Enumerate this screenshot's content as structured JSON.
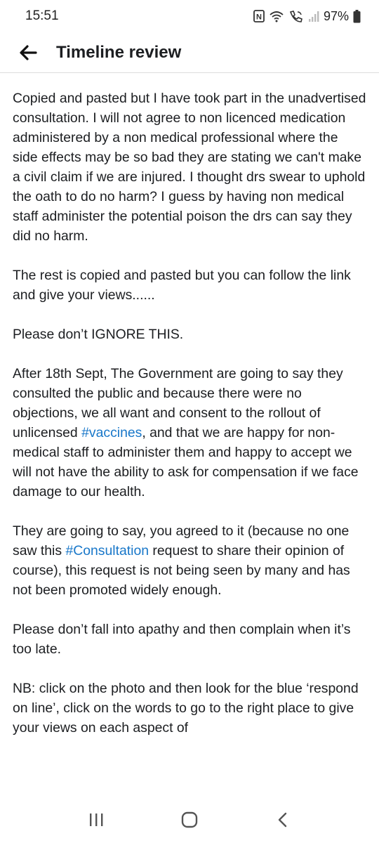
{
  "status_bar": {
    "time": "15:51",
    "battery_percent": "97%",
    "icons": [
      "nfc-icon",
      "wifi-icon",
      "wifi-call-icon",
      "signal-icon",
      "battery-icon"
    ]
  },
  "header": {
    "title": "Timeline review",
    "back_icon": "arrow-left-icon"
  },
  "post": {
    "p1": "Copied and pasted but I have took part in the unadvertised consultation. I will not agree to non licenced medication administered by a non medical professional where the side effects may be so bad they are stating we can't make a civil claim if we are injured. I thought drs swear to uphold the oath to do no harm? I guess by having non medical staff administer the potential poison the drs can say they did no harm.",
    "p2": "The rest is copied and pasted but you can follow the link and give your views......",
    "p3": "Please don’t IGNORE THIS.",
    "p4_before": "After 18th Sept, The Government are going to say they consulted the public and because there were no objections, we all want and consent to the rollout of unlicensed ",
    "p4_hashtag": "#vaccines",
    "p4_after": ", and that we are happy for non-medical staff to administer them and happy to accept we will not have the ability to ask for compensation if we face damage to our health.",
    "p5_before": "They are going to say, you agreed to it  (because no one saw this ",
    "p5_hashtag": "#Consultation",
    "p5_after": " request to share their opinion of course), this request is not being seen by many and has not been promoted widely enough.",
    "p6": "Please don’t fall into apathy and then complain when it’s too late.",
    "p7": "NB: click on the photo and then look for the blue ‘respond on line’,  click on the words to go to the right place to give your views on each aspect of"
  },
  "nav_bar": {
    "icons": [
      "recent-apps-icon",
      "home-icon",
      "back-icon"
    ]
  },
  "colors": {
    "hashtag": "#1877c9",
    "text": "#1c1e21",
    "background": "#ffffff"
  }
}
